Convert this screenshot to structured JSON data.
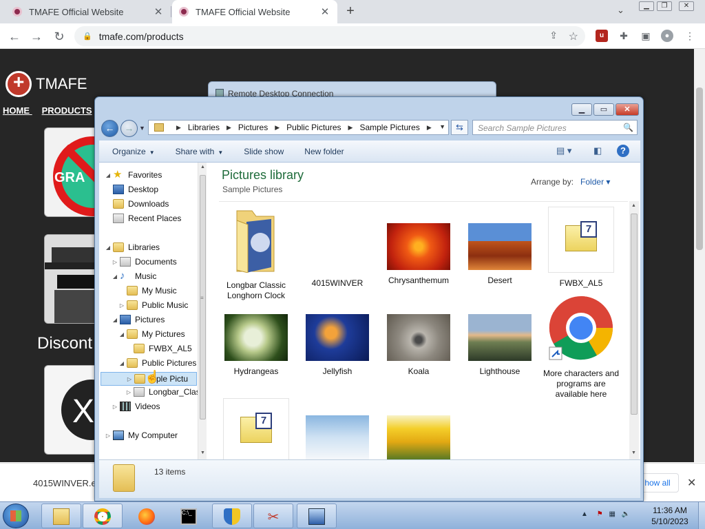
{
  "browser": {
    "tabs": [
      {
        "title": "TMAFE Official Website",
        "close": "✕"
      },
      {
        "title": "TMAFE Official Website",
        "close": "✕"
      }
    ],
    "new_tab": "+",
    "url": "tmafe.com/products",
    "ext_badge": "u"
  },
  "site": {
    "brand": "TMAFE",
    "nav_home": "HOME",
    "nav_products": "PRODUCTS",
    "card1_text": "GRA",
    "discont_text": "Discont"
  },
  "downloads": {
    "file": "4015WINVER.e",
    "show_all": "how all",
    "close": "✕"
  },
  "rdc": {
    "title": "Remote Desktop Connection"
  },
  "explorer": {
    "breadcrumbs": [
      "Libraries",
      "Pictures",
      "Public Pictures",
      "Sample Pictures"
    ],
    "search_placeholder": "Search Sample Pictures",
    "commands": {
      "organize": "Organize",
      "share": "Share with",
      "slideshow": "Slide show",
      "newfolder": "New folder"
    },
    "help": "?",
    "tree": {
      "favorites": "Favorites",
      "desktop": "Desktop",
      "downloads": "Downloads",
      "recent": "Recent Places",
      "libraries": "Libraries",
      "documents": "Documents",
      "music": "Music",
      "my_music": "My Music",
      "public_music": "Public Music",
      "pictures": "Pictures",
      "my_pictures": "My Pictures",
      "fwbx": "FWBX_AL5",
      "public_pictures": "Public Pictures",
      "sample_pictures": "mple Pictu",
      "longbar": "Longbar_Clas",
      "videos": "Videos",
      "my_computer": "My Computer"
    },
    "library_title": "Pictures library",
    "library_sub": "Sample Pictures",
    "arrange_label": "Arrange by:",
    "arrange_value": "Folder",
    "items": [
      "Longbar Classic Longhorn Clock",
      "4015WINVER",
      "Chrysanthemum",
      "Desert",
      "FWBX_AL5",
      "Hydrangeas",
      "Jellyfish",
      "Koala",
      "Lighthouse",
      "More characters and programs are available here"
    ],
    "status": "13 items"
  },
  "taskbar": {
    "time": "11:36 AM",
    "date": "5/10/2023"
  }
}
